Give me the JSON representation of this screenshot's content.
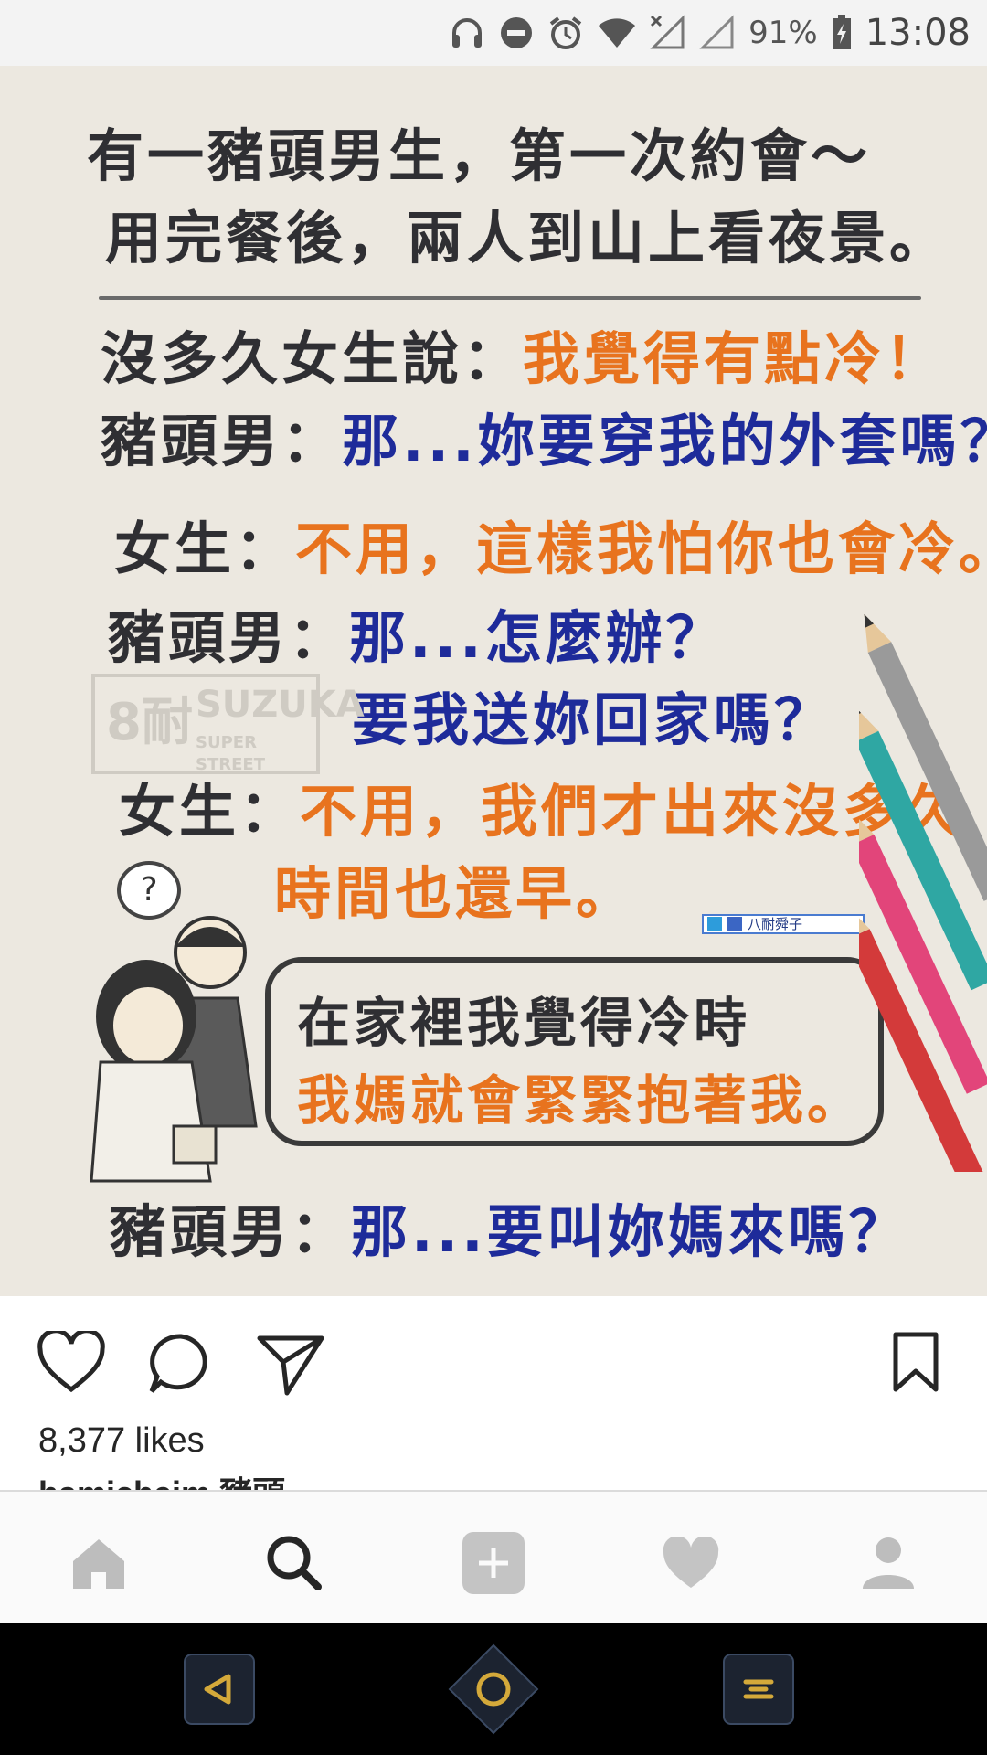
{
  "status_bar": {
    "battery_percent": "91%",
    "time": "13:08",
    "icons": [
      "headphones-icon",
      "do-not-disturb-icon",
      "alarm-icon",
      "wifi-icon",
      "no-signal-icon",
      "signal-icon",
      "battery-charging-icon"
    ]
  },
  "post_image": {
    "lines": [
      {
        "text": "有一豬頭男生，第一次約會～",
        "color": "dark"
      },
      {
        "text": "用完餐後，兩人到山上看夜景。",
        "color": "dark"
      },
      {
        "speaker": "沒多久女生說：",
        "text": "我覺得有點冷！",
        "color": "orange"
      },
      {
        "speaker": "豬頭男：",
        "text": "那...妳要穿我的外套嗎？",
        "color": "blue"
      },
      {
        "speaker": "女生：",
        "text": "不用，這樣我怕你也會冷。",
        "color": "orange"
      },
      {
        "speaker": "豬頭男：",
        "text": "那...怎麼辦？",
        "color": "blue"
      },
      {
        "text": "要我送妳回家嗎？",
        "color": "blue"
      },
      {
        "speaker": "女生：",
        "text": "不用，我們才出來沒多久",
        "color": "orange"
      },
      {
        "text": "時間也還早。",
        "color": "orange"
      },
      {
        "text": "在家裡我覺得冷時",
        "color": "dark"
      },
      {
        "text": "我媽就會緊緊抱著我。",
        "color": "orange"
      },
      {
        "speaker": "豬頭男：",
        "text": "那...要叫妳媽來嗎？",
        "color": "blue"
      }
    ],
    "watermark": {
      "big": "8耐",
      "brand": "SUZUKA",
      "tagline": "SUPER STREET"
    },
    "credit_tag": "八耐舜子",
    "thought_bubble": "?",
    "colors": {
      "dark": "#2f2f33",
      "orange": "#e8731e",
      "blue": "#1e2b9a",
      "paper": "#ece8e0"
    }
  },
  "actions": {
    "like_icon": "heart-outline-icon",
    "comment_icon": "comment-icon",
    "share_icon": "share-paper-plane-icon",
    "save_icon": "bookmark-icon",
    "likes_text": "8,377 likes",
    "caption_peek": "hamicheim 豬頭"
  },
  "bottom_nav": {
    "items": [
      {
        "name": "home",
        "icon": "home-icon",
        "active": false
      },
      {
        "name": "search",
        "icon": "search-icon",
        "active": true
      },
      {
        "name": "add",
        "icon": "add-post-icon",
        "active": false
      },
      {
        "name": "activity",
        "icon": "heart-icon",
        "active": false
      },
      {
        "name": "profile",
        "icon": "profile-icon",
        "active": false
      }
    ]
  },
  "system_nav": {
    "buttons": [
      "back-icon",
      "home-circle-icon",
      "recents-icon"
    ],
    "accent": "#d4a93a"
  }
}
